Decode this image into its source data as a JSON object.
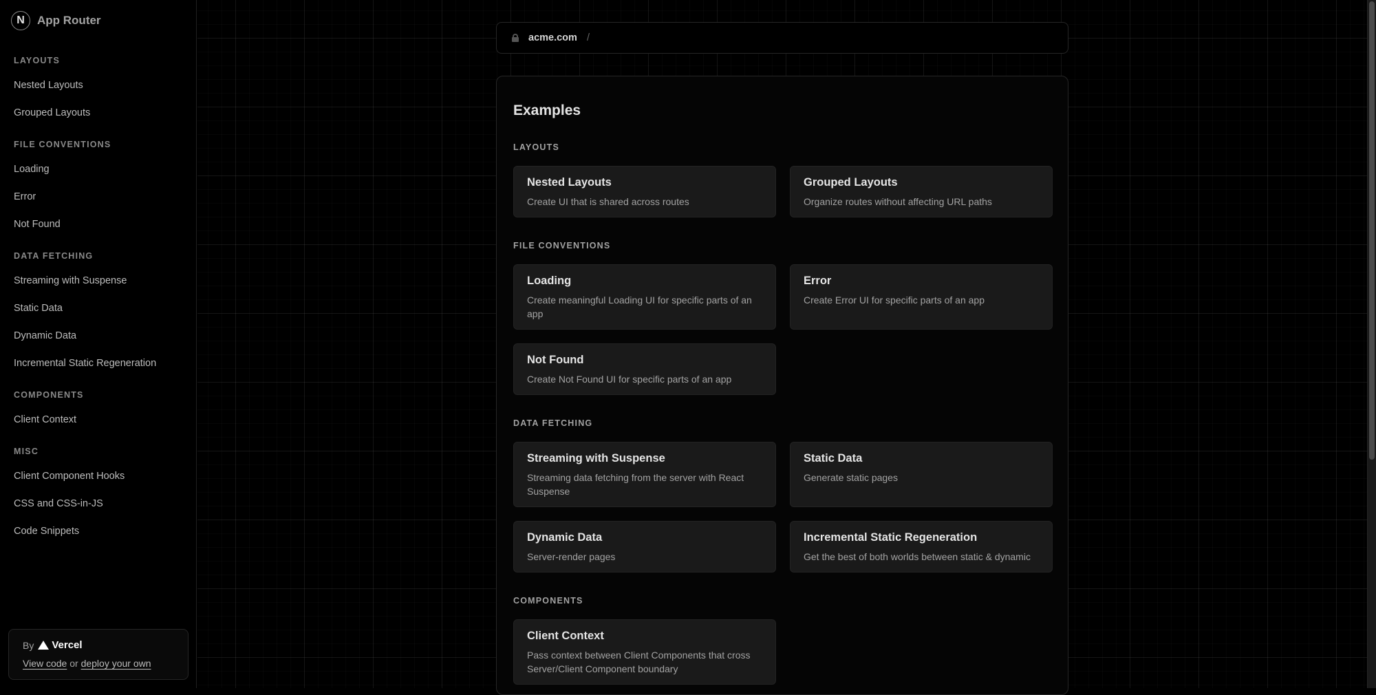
{
  "sidebar": {
    "brand_logo_letter": "N",
    "brand_title": "App Router",
    "groups": [
      {
        "title": "Layouts",
        "items": [
          "Nested Layouts",
          "Grouped Layouts"
        ]
      },
      {
        "title": "File Conventions",
        "items": [
          "Loading",
          "Error",
          "Not Found"
        ]
      },
      {
        "title": "Data Fetching",
        "items": [
          "Streaming with Suspense",
          "Static Data",
          "Dynamic Data",
          "Incremental Static Regeneration"
        ]
      },
      {
        "title": "Components",
        "items": [
          "Client Context"
        ]
      },
      {
        "title": "Misc",
        "items": [
          "Client Component Hooks",
          "CSS and CSS-in-JS",
          "Code Snippets"
        ]
      }
    ],
    "byline": {
      "by": "By",
      "vercel": "Vercel",
      "view_code": "View code",
      "or": "or",
      "deploy": "deploy your own"
    }
  },
  "addressbar": {
    "domain": "acme.com",
    "separator": "/"
  },
  "main": {
    "title": "Examples",
    "sections": [
      {
        "title": "Layouts",
        "cards": [
          {
            "title": "Nested Layouts",
            "desc": "Create UI that is shared across routes"
          },
          {
            "title": "Grouped Layouts",
            "desc": "Organize routes without affecting URL paths"
          }
        ]
      },
      {
        "title": "File Conventions",
        "cards": [
          {
            "title": "Loading",
            "desc": "Create meaningful Loading UI for specific parts of an app"
          },
          {
            "title": "Error",
            "desc": "Create Error UI for specific parts of an app"
          },
          {
            "title": "Not Found",
            "desc": "Create Not Found UI for specific parts of an app"
          }
        ]
      },
      {
        "title": "Data Fetching",
        "cards": [
          {
            "title": "Streaming with Suspense",
            "desc": "Streaming data fetching from the server with React Suspense"
          },
          {
            "title": "Static Data",
            "desc": "Generate static pages"
          },
          {
            "title": "Dynamic Data",
            "desc": "Server-render pages"
          },
          {
            "title": "Incremental Static Regeneration",
            "desc": "Get the best of both worlds between static & dynamic"
          }
        ]
      },
      {
        "title": "Components",
        "cards": [
          {
            "title": "Client Context",
            "desc": "Pass context between Client Components that cross Server/Client Component boundary"
          }
        ]
      }
    ]
  },
  "icons": {
    "lock": "lock-icon",
    "vercel": "vercel-logo-icon",
    "brand": "nextjs-logo-icon"
  },
  "colors": {
    "background": "#000000",
    "card": "#1a1a1a",
    "text_primary": "#e5e5e5",
    "text_secondary": "#a3a3a3"
  }
}
